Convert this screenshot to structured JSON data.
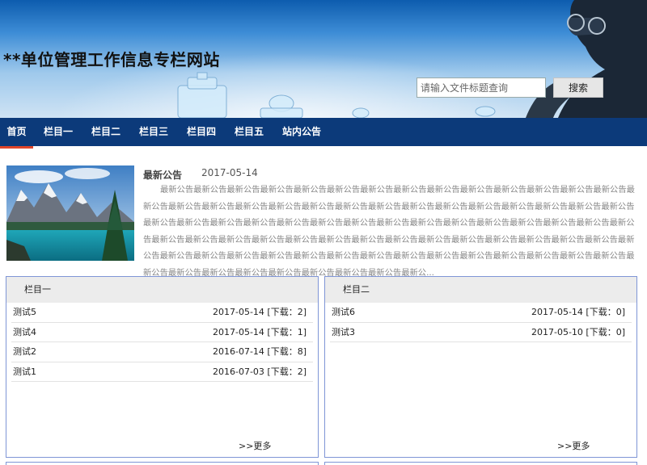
{
  "header": {
    "site_title": "**单位管理工作信息专栏网站",
    "search": {
      "placeholder": "请输入文件标题查询",
      "button_label": "搜索"
    }
  },
  "nav": {
    "items": [
      {
        "label": "首页",
        "active": true
      },
      {
        "label": "栏目一"
      },
      {
        "label": "栏目二"
      },
      {
        "label": "栏目三"
      },
      {
        "label": "栏目四"
      },
      {
        "label": "栏目五"
      },
      {
        "label": "站内公告"
      }
    ]
  },
  "announcement": {
    "title": "最新公告",
    "date": "2017-05-14",
    "body": "最新公告最新公告最新公告最新公告最新公告最新公告最新公告最新公告最新公告最新公告最新公告最新公告最新公告最新公告最新公告最新公告最新公告最新公告最新公告最新公告最新公告最新公告最新公告最新公告最新公告最新公告最新公告最新公告最新公告最新公告最新公告最新公告最新公告最新公告最新公告最新公告最新公告最新公告最新公告最新公告最新公告最新公告最新公告最新公告最新公告最新公告最新公告最新公告最新公告最新公告最新公告最新公告最新公告最新公告最新公告最新公告最新公告最新公告最新公告最新公告最新公告最新公告最新公告最新公告最新公告最新公告最新公告最新公告最新公告最新公告最新公告最新公告最新公告最新公告最新公告最新公告最新公告最新公告最新公告最新公告最新公告最新公..."
  },
  "panels": [
    {
      "title": "栏目一",
      "rows": [
        {
          "name": "测试5",
          "meta": "2017-05-14 [下载：2]"
        },
        {
          "name": "测试4",
          "meta": "2017-05-14 [下载：1]"
        },
        {
          "name": "测试2",
          "meta": "2016-07-14 [下载：8]"
        },
        {
          "name": "测试1",
          "meta": "2016-07-03 [下载：2]"
        }
      ],
      "more_label": ">>更多"
    },
    {
      "title": "栏目二",
      "rows": [
        {
          "name": "测试6",
          "meta": "2017-05-14 [下载：0]"
        },
        {
          "name": "测试3",
          "meta": "2017-05-10 [下载：0]"
        }
      ],
      "more_label": ">>更多"
    }
  ],
  "colors": {
    "nav_bg": "#0c3a7a",
    "active_underline": "#e0452a",
    "panel_border": "#7f95d6"
  }
}
